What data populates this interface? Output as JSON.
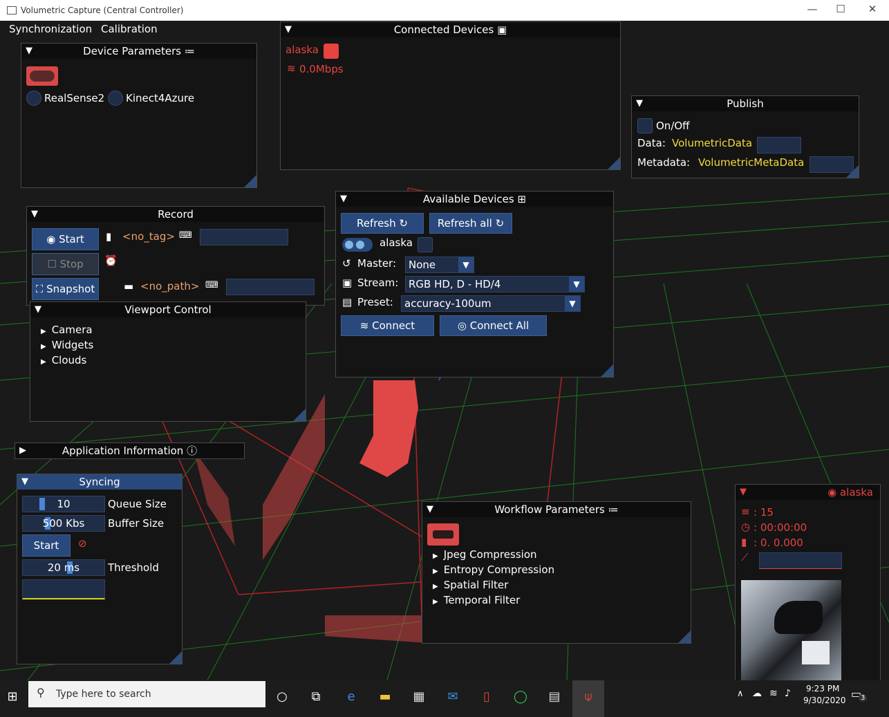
{
  "window": {
    "title": "Volumetric Capture (Central Controller)",
    "minimize": "—",
    "maximize": "☐",
    "close": "✕"
  },
  "menu": {
    "synchronization": "Synchronization",
    "calibration": "Calibration"
  },
  "device_parameters": {
    "title": "Device Parameters",
    "title_icon": "≔",
    "options": [
      "RealSense2",
      "Kinect4Azure"
    ]
  },
  "connected_devices": {
    "title": "Connected Devices",
    "device": "alaska",
    "bandwidth": "0.0Mbps"
  },
  "publish": {
    "title": "Publish",
    "toggle_label": "On/Off",
    "data_label": "Data:",
    "data_value": "VolumetricData",
    "metadata_label": "Metadata:",
    "metadata_value": "VolumetricMetaData"
  },
  "record": {
    "title": "Record",
    "start_label": "Start",
    "stop_label": "Stop",
    "snapshot_label": "Snapshot",
    "tag": "<no_tag>",
    "path": "<no_path>"
  },
  "available_devices": {
    "title": "Available Devices",
    "refresh_label": "Refresh",
    "refresh_all_label": "Refresh all",
    "device_name": "alaska",
    "master_label": "Master:",
    "master_value": "None",
    "stream_label": "Stream:",
    "stream_value": "RGB HD, D - HD/4",
    "preset_label": "Preset:",
    "preset_value": "accuracy-100um",
    "connect_label": "Connect",
    "connect_all_label": "Connect All"
  },
  "viewport_control": {
    "title": "Viewport Control",
    "items": [
      "Camera",
      "Widgets",
      "Clouds"
    ]
  },
  "application_information": {
    "title": "Application Information",
    "icon": "info-icon"
  },
  "syncing": {
    "title": "Syncing",
    "queue_size_value": "10",
    "queue_size_label": "Queue Size",
    "buffer_size_value": "500 Kbs",
    "buffer_size_label": "Buffer Size",
    "start_label": "Start",
    "threshold_value": "20 ms",
    "threshold_label": "Threshold"
  },
  "workflow_parameters": {
    "title": "Workflow Parameters",
    "items": [
      "Jpeg Compression",
      "Entropy Compression",
      "Spatial Filter",
      "Temporal Filter"
    ]
  },
  "preview": {
    "title": "alaska",
    "frames": ": 15",
    "time": ": 00:00:00",
    "stats": ": 0.  0.000"
  },
  "taskbar": {
    "search_placeholder": "Type here to search",
    "time": "9:23 PM",
    "date": "9/30/2020",
    "notifications": "3"
  },
  "colors": {
    "accent": "#29497c",
    "panel_bg": "#141414",
    "highlight_yellow": "#f1dc3a",
    "alert_red": "#e5443f"
  }
}
